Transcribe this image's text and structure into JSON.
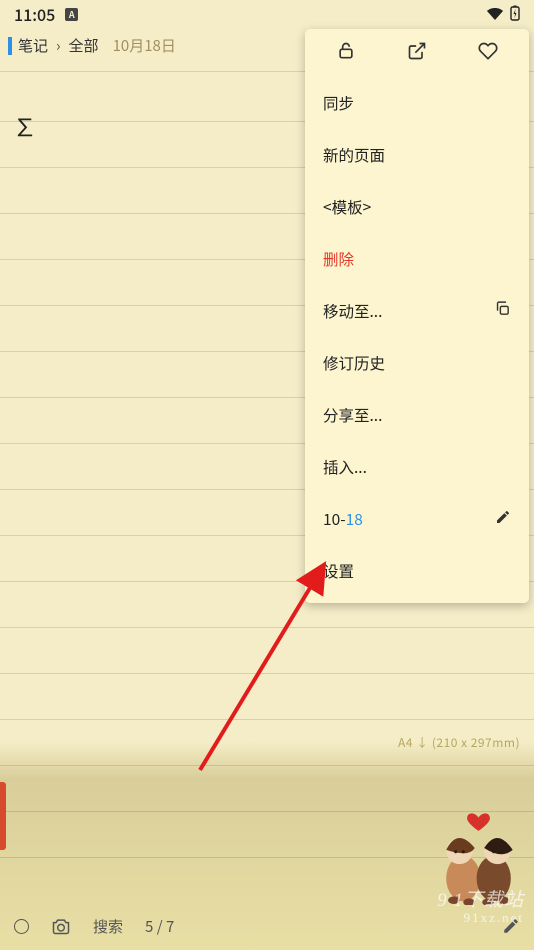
{
  "status": {
    "time": "11:05"
  },
  "breadcrumb": {
    "a": "笔记",
    "b": "全部",
    "date": "10月18日"
  },
  "content": {
    "sigma": "∑"
  },
  "menu": {
    "sync": "同步",
    "newPage": "新的页面",
    "template": "<模板>",
    "delete": "删除",
    "moveTo": "移动至...",
    "revisions": "修订历史",
    "shareTo": "分享至...",
    "insert": "插入...",
    "dateA": "10-",
    "dateB": "18",
    "settings": "设置"
  },
  "paper": {
    "spec": "A4 ↓ (210 x 297mm)"
  },
  "bottom": {
    "search": "搜索",
    "pages": "5 / 7"
  },
  "watermark": {
    "l1": "9 1下载站",
    "l2": "91xz.net"
  }
}
